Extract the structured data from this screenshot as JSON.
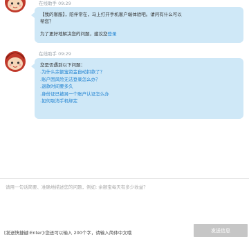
{
  "chat": {
    "messages": [
      {
        "sender": "在线助手",
        "time": "09:29",
        "line1": "【我的客服】，陪伴常在，马上打开手机客户端体验吧。请问有什么可以",
        "line2": "帮您？",
        "line3_prefix": "为了更好地解决您的问题，建议您",
        "line3_link": "登录"
      },
      {
        "sender": "在线助手",
        "time": "09:29",
        "intro": "您是否遇到以下问题：",
        "questions": [
          ".为什么余额宝资金自动扣款了？",
          ".账户因风险无法登录怎么办？",
          ".退款时间要多久",
          ".身份证已被另一个账户认证怎么办",
          ".如何取消手机绑定"
        ]
      }
    ]
  },
  "input": {
    "placeholder": "请用一句话简要、准确地描述您的问题，例如: 余额宝每天有多少收益？"
  },
  "footer": {
    "hint": "[发送快捷键:Enter]:您还可以输入 200个字，请输入简体中文哦",
    "send_label": "发送信息"
  },
  "colors": {
    "bubble": "#cfe8f7",
    "link": "#1a7fd0",
    "send_button": "#c6c6c6"
  },
  "icons": {
    "avatar": "assistant-avatar-icon"
  }
}
